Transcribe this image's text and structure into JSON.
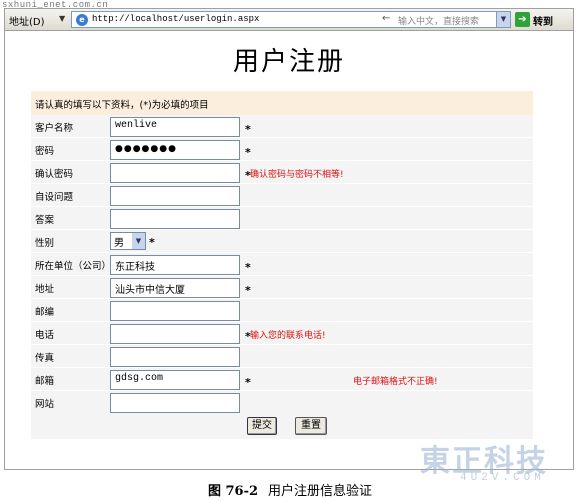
{
  "watermark_top": "sxhuni_enet.com.cn",
  "browser": {
    "address_label": "地址(D)",
    "url": "http://localhost/userlogin.aspx",
    "search_placeholder": "输入中文，直接搜索",
    "go_label": "转到"
  },
  "page": {
    "title": "用户注册",
    "notice": "请认真的填写以下资料，(*)为必填的项目"
  },
  "form": {
    "fields": [
      {
        "label": "客户名称",
        "value": "wenlive",
        "required": "*"
      },
      {
        "label": "密码",
        "value": "●●●●●●●",
        "required": "*"
      },
      {
        "label": "确认密码",
        "value": "",
        "required": "*",
        "error": "确认密码与密码不相等!"
      },
      {
        "label": "自设问题",
        "value": ""
      },
      {
        "label": "答案",
        "value": ""
      },
      {
        "label": "性别",
        "value": "男",
        "required": "*"
      },
      {
        "label": "所在单位（公司）",
        "value": "东正科技",
        "required": "*"
      },
      {
        "label": "地址",
        "value": "汕头市中信大厦",
        "required": "*"
      },
      {
        "label": "邮编",
        "value": ""
      },
      {
        "label": "电话",
        "value": "",
        "required": "*",
        "error": "输入您的联系电话!"
      },
      {
        "label": "传真",
        "value": ""
      },
      {
        "label": "邮箱",
        "value": "gdsg.com",
        "required": "*",
        "error": "电子邮箱格式不正确!"
      },
      {
        "label": "网站",
        "value": ""
      }
    ],
    "submit_label": "提交",
    "reset_label": "重置"
  },
  "caption": {
    "figure": "图 76-2",
    "text": "用户注册信息验证"
  },
  "watermark": {
    "logo": "東正科技",
    "sub": "4U2V.COM"
  },
  "colors": {
    "error": "#dd1111",
    "notice_bg": "#fbeedc",
    "form_bg": "#f4f4f4"
  }
}
